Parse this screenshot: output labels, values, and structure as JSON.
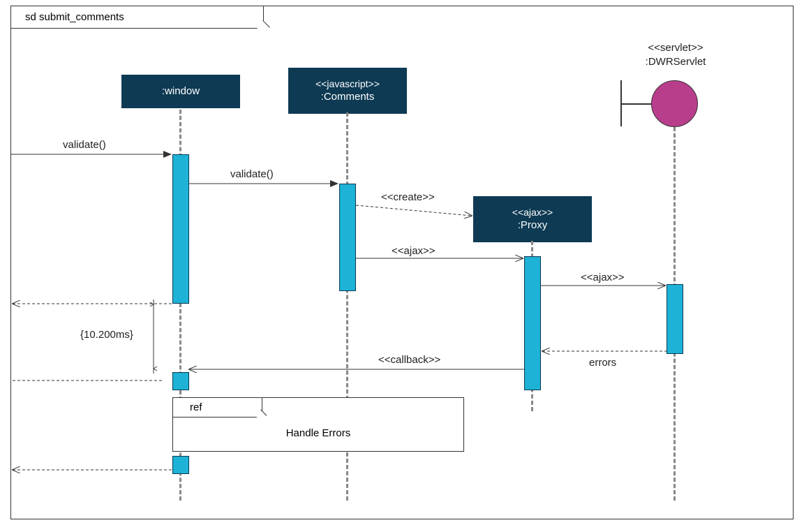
{
  "frame": {
    "title": "sd submit_comments"
  },
  "lifelines": {
    "window": {
      "label": ":window"
    },
    "comments": {
      "stereo": "<<javascript>>",
      "label": ":Comments"
    },
    "proxy": {
      "stereo": "<<ajax>>",
      "label": ":Proxy"
    },
    "servlet": {
      "stereo": "<<servlet>>",
      "label": ":DWRServlet"
    }
  },
  "messages": {
    "validate1": "validate()",
    "validate2": "validate()",
    "create": "<<create>>",
    "ajax1": "<<ajax>>",
    "ajax2": "<<ajax>>",
    "errors": "errors",
    "callback": "<<callback>>"
  },
  "constraint": "{10.200ms}",
  "ref": {
    "tag": "ref",
    "label": "Handle Errors"
  }
}
